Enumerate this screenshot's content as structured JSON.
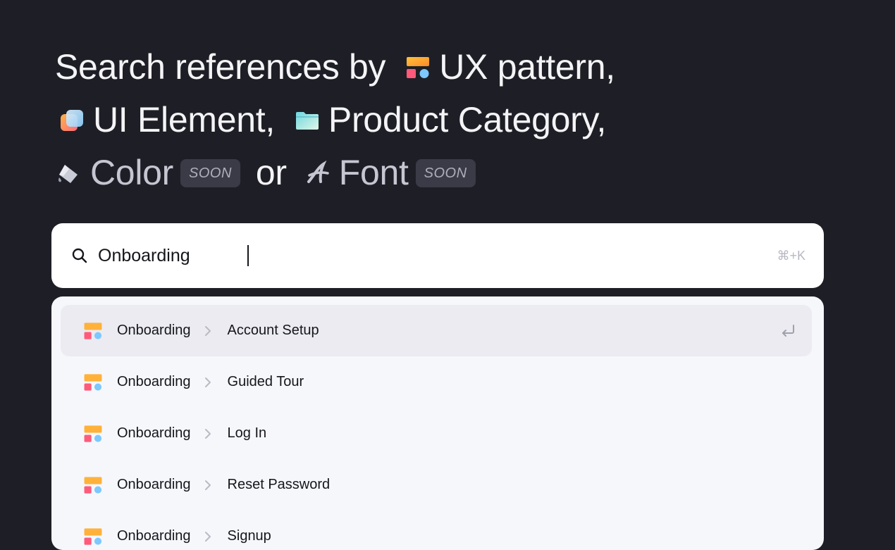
{
  "headline": {
    "line1_prefix": "Search references by",
    "ux_pattern": "UX pattern,",
    "ui_element": "UI Element,",
    "product_category": "Product Category,",
    "color": "Color",
    "soon_badge": "SOON",
    "or": "or",
    "font": "Font"
  },
  "search": {
    "value": "Onboarding",
    "shortcut": "⌘+K"
  },
  "results": [
    {
      "category": "Onboarding",
      "item": "Account Setup",
      "active": true
    },
    {
      "category": "Onboarding",
      "item": "Guided Tour",
      "active": false
    },
    {
      "category": "Onboarding",
      "item": "Log In",
      "active": false
    },
    {
      "category": "Onboarding",
      "item": "Reset Password",
      "active": false
    },
    {
      "category": "Onboarding",
      "item": "Signup",
      "active": false
    }
  ],
  "colors": {
    "background": "#1e1f26",
    "active_row": "#ebebf1",
    "soon_badge": "#3a3b46"
  }
}
